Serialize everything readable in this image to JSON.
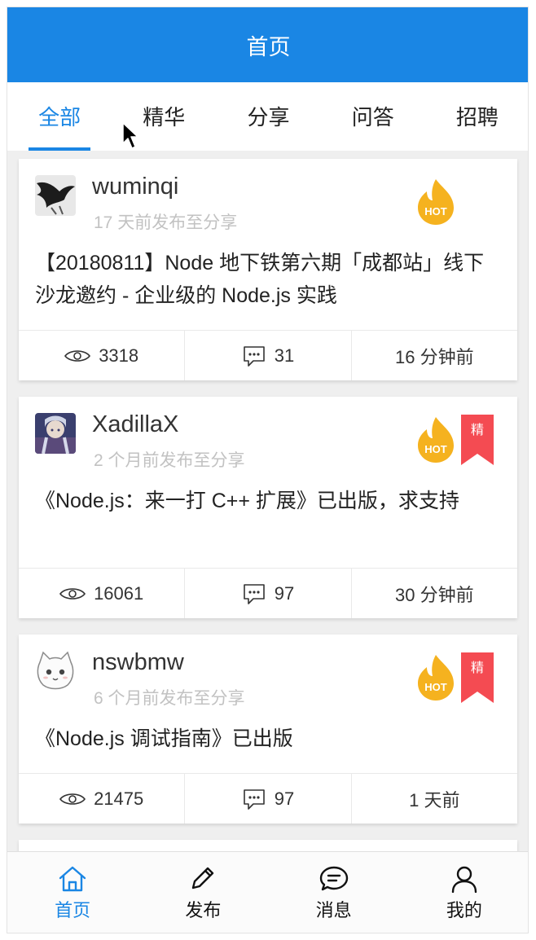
{
  "header": {
    "title": "首页"
  },
  "tabs": [
    {
      "label": "全部",
      "active": true
    },
    {
      "label": "精华",
      "active": false
    },
    {
      "label": "分享",
      "active": false
    },
    {
      "label": "问答",
      "active": false
    },
    {
      "label": "招聘",
      "active": false
    }
  ],
  "badges": {
    "hot": "HOT",
    "jing": "精"
  },
  "colors": {
    "accent": "#1a86e4",
    "hot": "#f5b21f",
    "jing": "#f44b52"
  },
  "topics": [
    {
      "author": "wuminqi",
      "meta": "17 天前发布至分享",
      "title": "【20180811】Node 地下铁第六期「成都站」线下沙龙邀约 - 企业级的 Node.js 实践",
      "hot": true,
      "good": false,
      "views": "3318",
      "replies": "31",
      "last_reply": "16 分钟前"
    },
    {
      "author": "XadillaX",
      "meta": "2 个月前发布至分享",
      "title": "《Node.js：来一打 C++ 扩展》已出版，求支持",
      "hot": true,
      "good": true,
      "views": "16061",
      "replies": "97",
      "last_reply": "30 分钟前"
    },
    {
      "author": "nswbmw",
      "meta": "6 个月前发布至分享",
      "title": "《Node.js 调试指南》已出版",
      "hot": true,
      "good": true,
      "views": "21475",
      "replies": "97",
      "last_reply": "1 天前"
    }
  ],
  "bottom_nav": [
    {
      "label": "首页",
      "icon": "home-icon",
      "active": true
    },
    {
      "label": "发布",
      "icon": "pencil-icon",
      "active": false
    },
    {
      "label": "消息",
      "icon": "message-icon",
      "active": false
    },
    {
      "label": "我的",
      "icon": "user-icon",
      "active": false
    }
  ]
}
